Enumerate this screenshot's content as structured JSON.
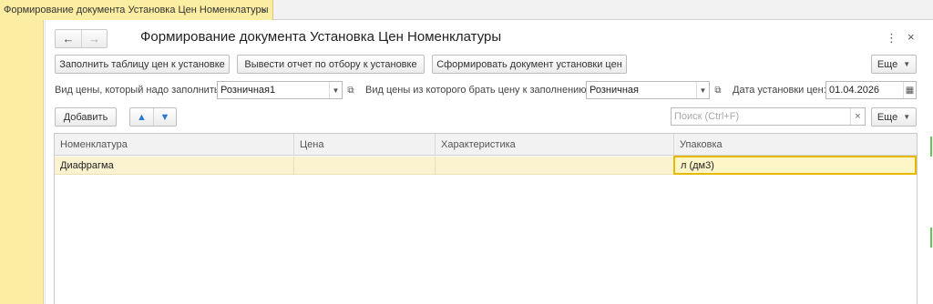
{
  "tab": {
    "title": "Формирование документа Установка Цен Номенклатуры",
    "close": "×"
  },
  "window": {
    "title": "Формирование документа Установка Цен Номенклатуры",
    "back": "←",
    "forward": "→",
    "menu": "⋮",
    "close": "×"
  },
  "toolbar": {
    "fill_prices": "Заполнить таблицу цен к установке",
    "report": "Вывести отчет по отбору к установке",
    "create_doc": "Сформировать документ установки цен",
    "more": "Еще"
  },
  "params": {
    "price_type_label": "Вид цены, который надо заполнить:",
    "price_type_value": "Розничная1",
    "source_price_label": "Вид цены из которого брать цену к заполнению:",
    "source_price_value": "Розничная",
    "date_label": "Дата установки цен:",
    "date_value": "01.04.2026"
  },
  "table_toolbar": {
    "add": "Добавить",
    "search_placeholder": "Поиск (Ctrl+F)",
    "more": "Еще"
  },
  "table": {
    "columns": [
      "Номенклатура",
      "Цена",
      "Характеристика",
      "Упаковка"
    ],
    "rows": [
      {
        "item": "Диафрагма",
        "price": "",
        "characteristic": "",
        "package": "л (дм3)"
      }
    ]
  },
  "colors": {
    "accent_yellow": "#fbeda1",
    "selected_border": "#e6b800",
    "arrow_blue": "#2b7bd6"
  }
}
